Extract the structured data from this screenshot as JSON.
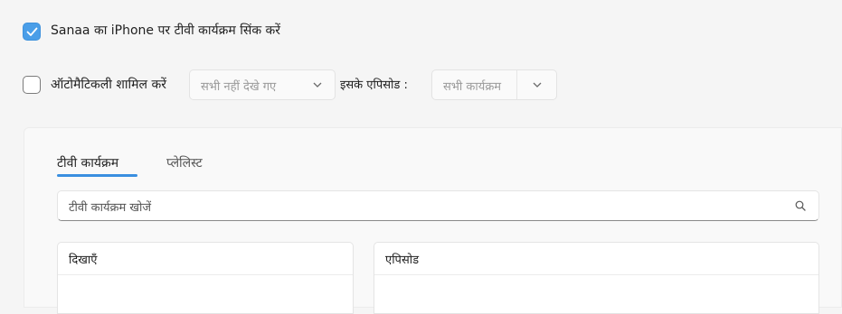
{
  "sync": {
    "checkbox_checked": true,
    "label": "Sanaa का iPhone पर टीवी कार्यक्रम सिंक करें"
  },
  "auto_include": {
    "checkbox_checked": false,
    "label": "ऑटोमैटिकली शामिल करें",
    "episodes_filter": "सभी नहीं देखे गए",
    "of_label": "इसके एपिसोड :",
    "shows_filter": "सभी कार्यक्रम"
  },
  "tabs": [
    {
      "label": "टीवी कार्यक्रम",
      "selected": true
    },
    {
      "label": "प्लेलिस्ट",
      "selected": false
    }
  ],
  "search": {
    "placeholder": "टीवी कार्यक्रम खोजें"
  },
  "lists": {
    "shows_header": "दिखाएँ",
    "episodes_header": "एपिसोड"
  },
  "colors": {
    "accent": "#3a8fe0",
    "checkbox": "#4a9ee8"
  },
  "icons": [
    "checkmark-icon",
    "chevron-down-icon",
    "search-icon"
  ]
}
